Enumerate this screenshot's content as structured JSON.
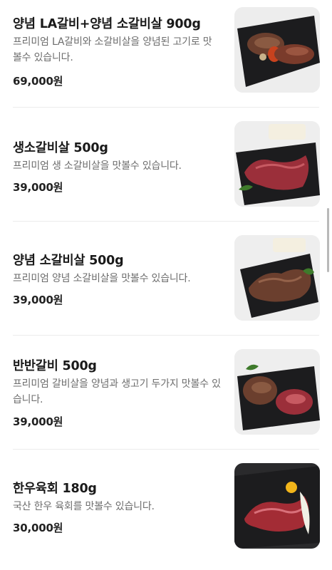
{
  "menu": {
    "items": [
      {
        "name": "양념 LA갈비+양념 소갈비살 900g",
        "description": "프리미엄 LA갈비와 소갈비살을 양념된 고기로 맛볼수 있습니다.",
        "price": "69,000원",
        "image": "marinated-la-galbi-and-rib-meat-photo"
      },
      {
        "name": "생소갈비살 500g",
        "description": "프리미엄 생 소갈비살을 맛볼수 있습니다.",
        "price": "39,000원",
        "image": "fresh-rib-meat-photo"
      },
      {
        "name": "양념 소갈비살 500g",
        "description": "프리미엄 양념 소갈비살을 맛볼수 있습니다.",
        "price": "39,000원",
        "image": "marinated-rib-meat-photo"
      },
      {
        "name": "반반갈비 500g",
        "description": "프리미엄 갈비살을 양념과 생고기 두가지 맛볼수 있습니다.",
        "price": "39,000원",
        "image": "half-and-half-galbi-photo"
      },
      {
        "name": "한우육회 180g",
        "description": "국산 한우 육회를 맛볼수 있습니다.",
        "price": "30,000원",
        "image": "hanwoo-yukhoe-photo"
      }
    ]
  },
  "colors": {
    "title": "#1a1a1a",
    "description": "#6d6d6d",
    "divider": "#ececec",
    "tray": "#1c1c1e",
    "fresh_meat": "#9b2f3a",
    "marinated_meat": "#6b3f2e"
  }
}
